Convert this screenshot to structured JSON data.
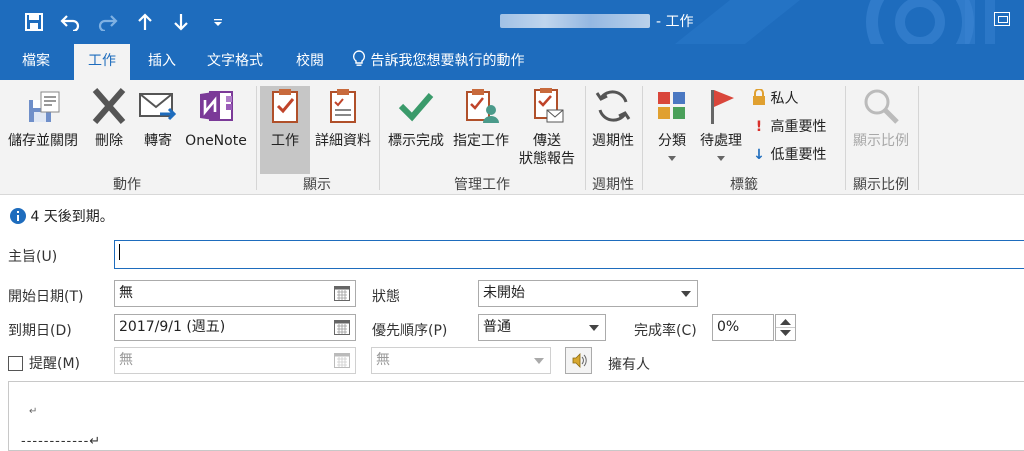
{
  "window": {
    "title_suffix": "- 工作"
  },
  "quick_access": {
    "icons": [
      "save-icon",
      "undo-icon",
      "redo-icon",
      "up-arrow-icon",
      "down-arrow-icon",
      "customize-icon"
    ]
  },
  "tabs": [
    {
      "label": "檔案",
      "active": false
    },
    {
      "label": "工作",
      "active": true
    },
    {
      "label": "插入",
      "active": false
    },
    {
      "label": "文字格式",
      "active": false
    },
    {
      "label": "校閱",
      "active": false
    }
  ],
  "tell_me": "告訴我您想要執行的動作",
  "ribbon": {
    "groups": {
      "actions": "動作",
      "show": "顯示",
      "manage": "管理工作",
      "recurrence": "週期性",
      "tags": "標籤",
      "zoom": "顯示比例"
    },
    "buttons": {
      "save_close": "儲存並關閉",
      "delete": "刪除",
      "forward": "轉寄",
      "onenote": "OneNote",
      "task": "工作",
      "details": "詳細資料",
      "mark_complete": "標示完成",
      "assign": "指定工作",
      "send_status_1": "傳送",
      "send_status_2": "狀態報告",
      "recurrence": "週期性",
      "categorize": "分類",
      "follow_up": "待處理",
      "private": "私人",
      "high": "高重要性",
      "low": "低重要性",
      "zoom": "顯示比例"
    }
  },
  "infobar": {
    "text": "4 天後到期。"
  },
  "form": {
    "subject_label": "主旨(U)",
    "subject_value": "",
    "start_label": "開始日期(T)",
    "start_value": "無",
    "due_label": "到期日(D)",
    "due_value": "2017/9/1 (週五)",
    "reminder_label": "提醒(M)",
    "reminder_date": "無",
    "reminder_time": "無",
    "status_label": "狀態",
    "status_value": "未開始",
    "priority_label": "優先順序(P)",
    "priority_value": "普通",
    "complete_label": "完成率(C)",
    "complete_value": "0%",
    "owner_label": "擁有人"
  },
  "body": {
    "line1": "↵",
    "line2": "------------↵"
  },
  "colors": {
    "accent": "#1e6cbd",
    "ribbon_bg": "#f3f3f3",
    "onenote": "#7b3a98",
    "flag": "#d9463b",
    "check": "#3a9a6a",
    "info": "#1e6cbd"
  }
}
